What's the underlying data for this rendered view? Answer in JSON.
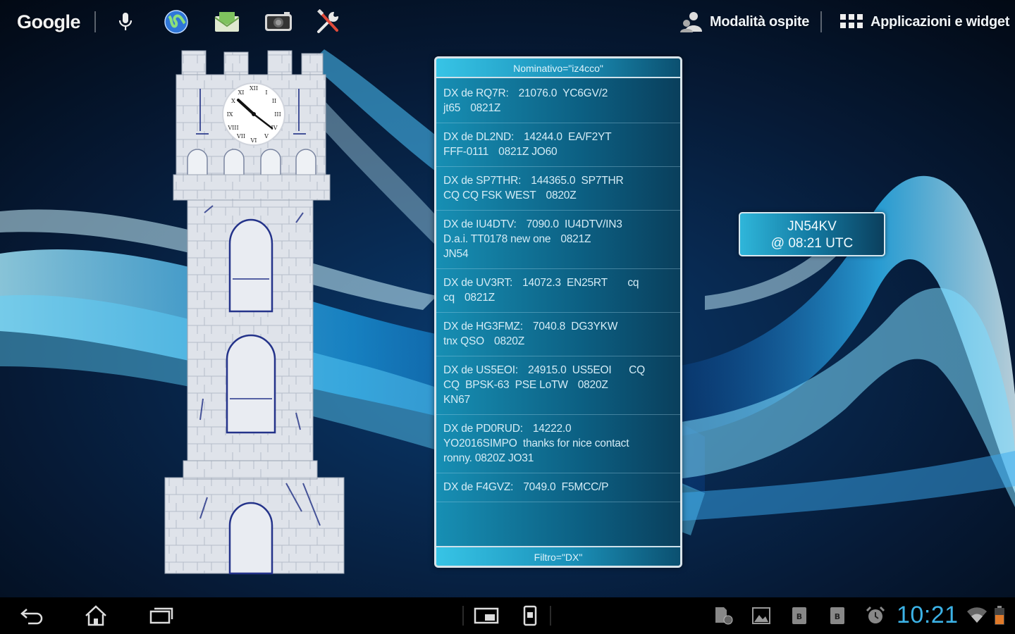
{
  "topbar": {
    "google_label": "Google",
    "guest_mode_label": "Modalità ospite",
    "apps_label": "Applicazioni e widget",
    "icons": [
      "microphone-icon",
      "globe-icon",
      "mail-icon",
      "camera-icon",
      "tools-icon",
      "person-icon",
      "apps-grid-icon"
    ]
  },
  "dx_widget": {
    "header": "Nominativo=\"iz4cco\"",
    "footer": "Filtro=\"DX\"",
    "spots": [
      {
        "lines": [
          [
            "DX de RQ7R:",
            "21076.0  YC6GV/2"
          ],
          [
            "jt65",
            "0821Z"
          ]
        ]
      },
      {
        "lines": [
          [
            "DX de DL2ND:",
            "14244.0  EA/F2YT"
          ],
          [
            "FFF-0111",
            "0821Z JO60"
          ]
        ]
      },
      {
        "lines": [
          [
            "DX de SP7THR:",
            "144365.0  SP7THR"
          ],
          [
            "CQ CQ FSK WEST",
            "0820Z"
          ]
        ]
      },
      {
        "lines": [
          [
            "DX de IU4DTV:",
            "7090.0  IU4DTV/IN3"
          ],
          [
            "D.a.i. TT0178 new one",
            "0821Z"
          ],
          [
            "JN54",
            ""
          ]
        ]
      },
      {
        "lines": [
          [
            "DX de UV3RT:",
            "14072.3  EN25RT       cq"
          ],
          [
            "cq",
            "0821Z"
          ]
        ]
      },
      {
        "lines": [
          [
            "DX de HG3FMZ:",
            "7040.8  DG3YKW"
          ],
          [
            "tnx QSO",
            "0820Z"
          ]
        ]
      },
      {
        "lines": [
          [
            "DX de US5EOI:",
            "24915.0  US5EOI      CQ"
          ],
          [
            "CQ  BPSK-63  PSE LoTW",
            "0820Z"
          ],
          [
            "KN67",
            ""
          ]
        ]
      },
      {
        "lines": [
          [
            "DX de PD0RUD:",
            "14222.0"
          ],
          [
            "YO2016SIMPO  thanks for nice contact",
            ""
          ],
          [
            "ronny. 0820Z JO31",
            ""
          ]
        ]
      },
      {
        "lines": [
          [
            "DX de F4GVZ:",
            "7049.0  F5MCC/P"
          ]
        ]
      }
    ]
  },
  "locator": {
    "grid": "JN54KV",
    "time": "@ 08:21 UTC"
  },
  "navbar": {
    "clock": "10:21",
    "icons": [
      "back-icon",
      "home-icon",
      "recent-apps-icon",
      "small-apps-icon",
      "screenshot-icon",
      "sd-card-icon",
      "gallery-icon",
      "notification-icon",
      "notification-icon",
      "alarm-icon",
      "wifi-icon",
      "battery-icon"
    ]
  },
  "colors": {
    "accent_clock": "#3cb2e6",
    "widget_blue": "#178fb4",
    "background": "#04101e"
  }
}
